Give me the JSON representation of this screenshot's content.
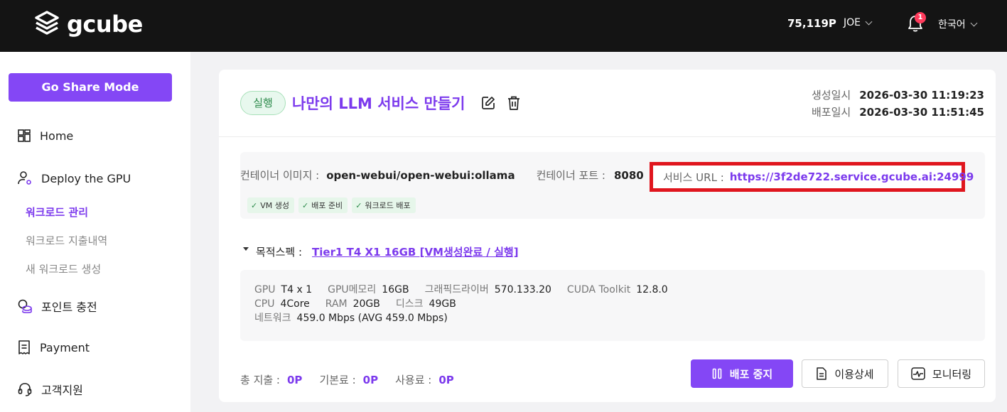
{
  "header": {
    "logo_text": "gcube",
    "points": "75,119P",
    "user": "JOE",
    "notification_count": "1",
    "language": "한국어"
  },
  "sidebar": {
    "share_button": "Go Share Mode",
    "items": [
      {
        "label": "Home",
        "icon": "grid-icon"
      },
      {
        "label": "Deploy the GPU",
        "icon": "user-gear-icon"
      },
      {
        "label": "포인트 충전",
        "icon": "coins-icon"
      },
      {
        "label": "Payment",
        "icon": "receipt-icon"
      },
      {
        "label": "고객지원",
        "icon": "headset-icon"
      }
    ],
    "subitems": [
      {
        "label": "워크로드 관리",
        "active": true
      },
      {
        "label": "워크로드 지출내역",
        "active": false
      },
      {
        "label": "새 워크로드 생성",
        "active": false
      }
    ]
  },
  "workload": {
    "status": "실행",
    "title": "나만의 LLM 서비스 만들기",
    "created_label": "생성일시",
    "created_value": "2026-03-30 11:19:23",
    "deployed_label": "배포일시",
    "deployed_value": "2026-03-30 11:51:45",
    "image_label": "컨테이너 이미지 :",
    "image_value": "open-webui/open-webui:ollama",
    "port_label": "컨테이너 포트 :",
    "port_value": "8080",
    "url_label": "서비스 URL :",
    "url_value": "https://3f2de722.service.gcube.ai:24999",
    "chips": [
      "VM 생성",
      "배포 준비",
      "워크로드 배포"
    ],
    "spec_label": "목적스펙 :",
    "spec_value": "Tier1 T4 X1 16GB [VM생성완료 / 실행]",
    "specs": {
      "gpu_k": "GPU",
      "gpu_v": "T4 x 1",
      "gpumem_k": "GPU메모리",
      "gpumem_v": "16GB",
      "driver_k": "그래픽드라이버",
      "driver_v": "570.133.20",
      "cuda_k": "CUDA Toolkit",
      "cuda_v": "12.8.0",
      "cpu_k": "CPU",
      "cpu_v": "4Core",
      "ram_k": "RAM",
      "ram_v": "20GB",
      "disk_k": "디스크",
      "disk_v": "49GB",
      "net_k": "네트워크",
      "net_v": "459.0 Mbps (AVG 459.0 Mbps)"
    },
    "costs": {
      "total_label": "총 지출 :",
      "total_value": "0P",
      "base_label": "기본료 :",
      "base_value": "0P",
      "usage_label": "사용료 :",
      "usage_value": "0P"
    },
    "buttons": {
      "stop": "배포 중지",
      "detail": "이용상세",
      "monitor": "모니터링"
    }
  },
  "colors": {
    "accent": "#8447f5",
    "highlight": "#e0161e",
    "status_green": "#2e8b4c"
  }
}
